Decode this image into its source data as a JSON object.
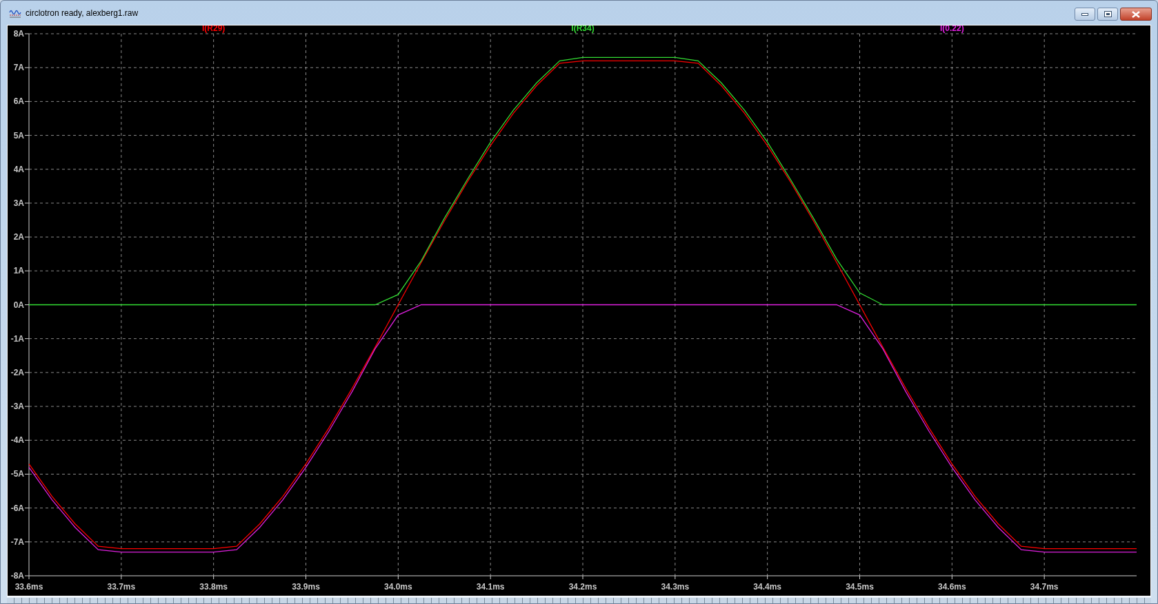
{
  "window": {
    "title": "circlotron ready, alexberg1.raw"
  },
  "plot": {
    "chart_data": {
      "type": "line",
      "x": [
        33.6,
        33.625,
        33.65,
        33.675,
        33.7,
        33.725,
        33.75,
        33.775,
        33.8,
        33.825,
        33.85,
        33.875,
        33.9,
        33.925,
        33.95,
        33.975,
        34.0,
        34.025,
        34.05,
        34.075,
        34.1,
        34.125,
        34.15,
        34.175,
        34.2,
        34.225,
        34.25,
        34.275,
        34.3,
        34.325,
        34.35,
        34.375,
        34.4,
        34.425,
        34.45,
        34.475,
        34.5,
        34.525,
        34.55,
        34.575,
        34.6,
        34.625,
        34.65,
        34.675,
        34.7,
        34.725,
        34.75,
        34.775,
        34.8
      ],
      "series": [
        {
          "name": "I(R29)",
          "color": "#ff0000",
          "values": [
            -4.7,
            -5.66,
            -6.47,
            -7.13,
            -7.2,
            -7.2,
            -7.2,
            -7.2,
            -7.2,
            -7.13,
            -6.47,
            -5.66,
            -4.7,
            -3.63,
            -2.47,
            -1.25,
            0,
            1.25,
            2.47,
            3.63,
            4.7,
            5.66,
            6.47,
            7.13,
            7.2,
            7.2,
            7.2,
            7.2,
            7.2,
            7.13,
            6.47,
            5.66,
            4.7,
            3.63,
            2.47,
            1.25,
            0,
            -1.25,
            -2.47,
            -3.63,
            -4.7,
            -5.66,
            -6.47,
            -7.13,
            -7.2,
            -7.2,
            -7.2,
            -7.2,
            -7.2
          ]
        },
        {
          "name": "I(R34)",
          "color": "#33dd33",
          "values": [
            0,
            0,
            0,
            0,
            0,
            0,
            0,
            0,
            0,
            0,
            0,
            0,
            0,
            0,
            0,
            0,
            0.3,
            1.3,
            2.55,
            3.7,
            4.8,
            5.75,
            6.55,
            7.2,
            7.3,
            7.3,
            7.3,
            7.3,
            7.3,
            7.2,
            6.55,
            5.75,
            4.8,
            3.7,
            2.55,
            1.35,
            0.35,
            0,
            0,
            0,
            0,
            0,
            0,
            0,
            0,
            0,
            0,
            0,
            0
          ]
        },
        {
          "name": "I(0.22)",
          "color": "#e020e0",
          "values": [
            -4.8,
            -5.76,
            -6.57,
            -7.23,
            -7.3,
            -7.3,
            -7.3,
            -7.3,
            -7.3,
            -7.23,
            -6.57,
            -5.76,
            -4.8,
            -3.73,
            -2.57,
            -1.3,
            -0.3,
            0,
            0,
            0,
            0,
            0,
            0,
            0,
            0,
            0,
            0,
            0,
            0,
            0,
            0,
            0,
            0,
            0,
            0,
            0,
            -0.3,
            -1.3,
            -2.57,
            -3.73,
            -4.8,
            -5.76,
            -6.57,
            -7.23,
            -7.3,
            -7.3,
            -7.3,
            -7.3,
            -7.3
          ]
        }
      ],
      "grid": true,
      "xlim": [
        33.6,
        34.8
      ],
      "ylim": [
        -8,
        8
      ],
      "xticks": [
        {
          "value": 33.6,
          "label": "33.6ms"
        },
        {
          "value": 33.7,
          "label": "33.7ms"
        },
        {
          "value": 33.8,
          "label": "33.8ms"
        },
        {
          "value": 33.9,
          "label": "33.9ms"
        },
        {
          "value": 34.0,
          "label": "34.0ms"
        },
        {
          "value": 34.1,
          "label": "34.1ms"
        },
        {
          "value": 34.2,
          "label": "34.2ms"
        },
        {
          "value": 34.3,
          "label": "34.3ms"
        },
        {
          "value": 34.4,
          "label": "34.4ms"
        },
        {
          "value": 34.5,
          "label": "34.5ms"
        },
        {
          "value": 34.6,
          "label": "34.6ms"
        },
        {
          "value": 34.7,
          "label": "34.7ms"
        }
      ],
      "yticks": [
        {
          "value": 8,
          "label": "8A"
        },
        {
          "value": 7,
          "label": "7A"
        },
        {
          "value": 6,
          "label": "6A"
        },
        {
          "value": 5,
          "label": "5A"
        },
        {
          "value": 4,
          "label": "4A"
        },
        {
          "value": 3,
          "label": "3A"
        },
        {
          "value": 2,
          "label": "2A"
        },
        {
          "value": 1,
          "label": "1A"
        },
        {
          "value": 0,
          "label": "0A"
        },
        {
          "value": -1,
          "label": "-1A"
        },
        {
          "value": -2,
          "label": "-2A"
        },
        {
          "value": -3,
          "label": "-3A"
        },
        {
          "value": -4,
          "label": "-4A"
        },
        {
          "value": -5,
          "label": "-5A"
        },
        {
          "value": -6,
          "label": "-6A"
        },
        {
          "value": -7,
          "label": "-7A"
        },
        {
          "value": -8,
          "label": "-8A"
        }
      ]
    }
  }
}
